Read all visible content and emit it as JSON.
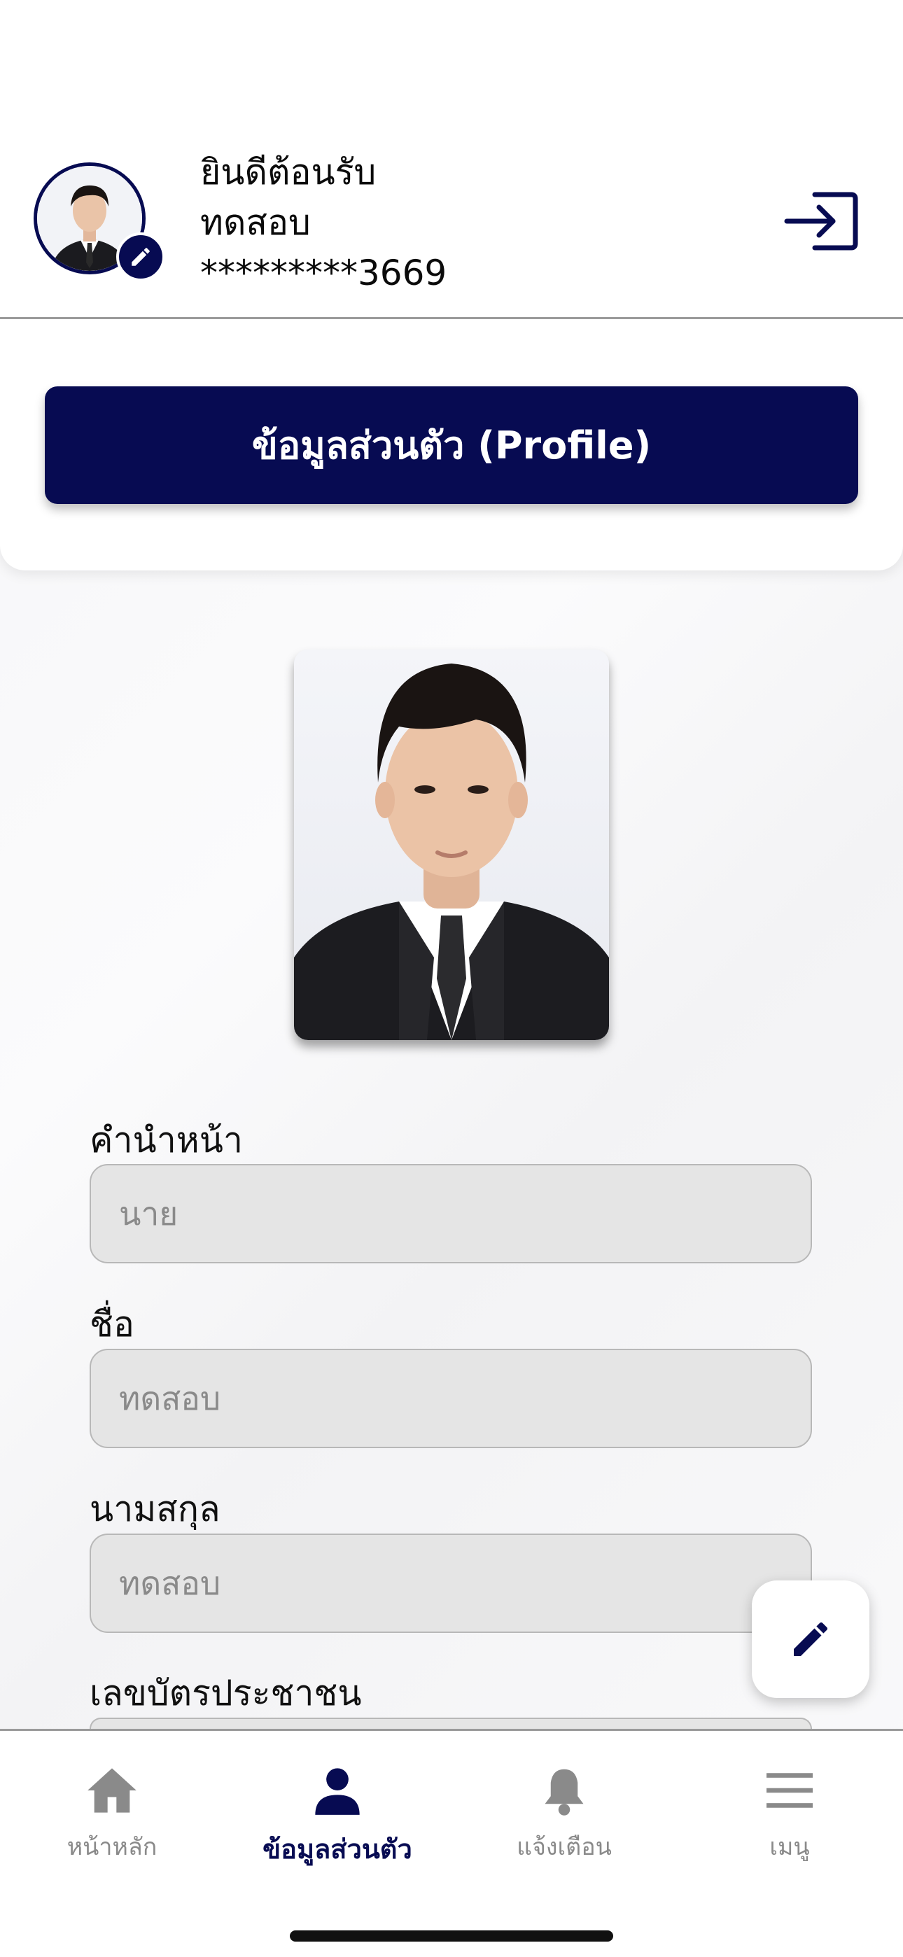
{
  "header": {
    "greeting": "ยินดีต้อนรับ",
    "user_name": "ทดสอบ",
    "masked_id": "*********3669"
  },
  "profile_button": {
    "label": "ข้อมูลส่วนตัว (Profile)"
  },
  "form": {
    "fields": [
      {
        "label": "คำนำหน้า",
        "value": "นาย"
      },
      {
        "label": "ชื่อ",
        "value": "ทดสอบ"
      },
      {
        "label": "นามสกุล",
        "value": "ทดสอบ"
      },
      {
        "label": "เลขบัตรประชาชน",
        "value": ""
      }
    ]
  },
  "tabbar": {
    "items": [
      {
        "label": "หน้าหลัก",
        "icon": "home-icon",
        "active": false
      },
      {
        "label": "ข้อมูลส่วนตัว",
        "icon": "person-icon",
        "active": true
      },
      {
        "label": "แจ้งเตือน",
        "icon": "bell-icon",
        "active": false
      },
      {
        "label": "เมนู",
        "icon": "menu-icon",
        "active": false
      }
    ]
  },
  "colors": {
    "primary": "#070b52",
    "inactive": "#8a8a8a",
    "input_bg": "#e5e5e5"
  }
}
